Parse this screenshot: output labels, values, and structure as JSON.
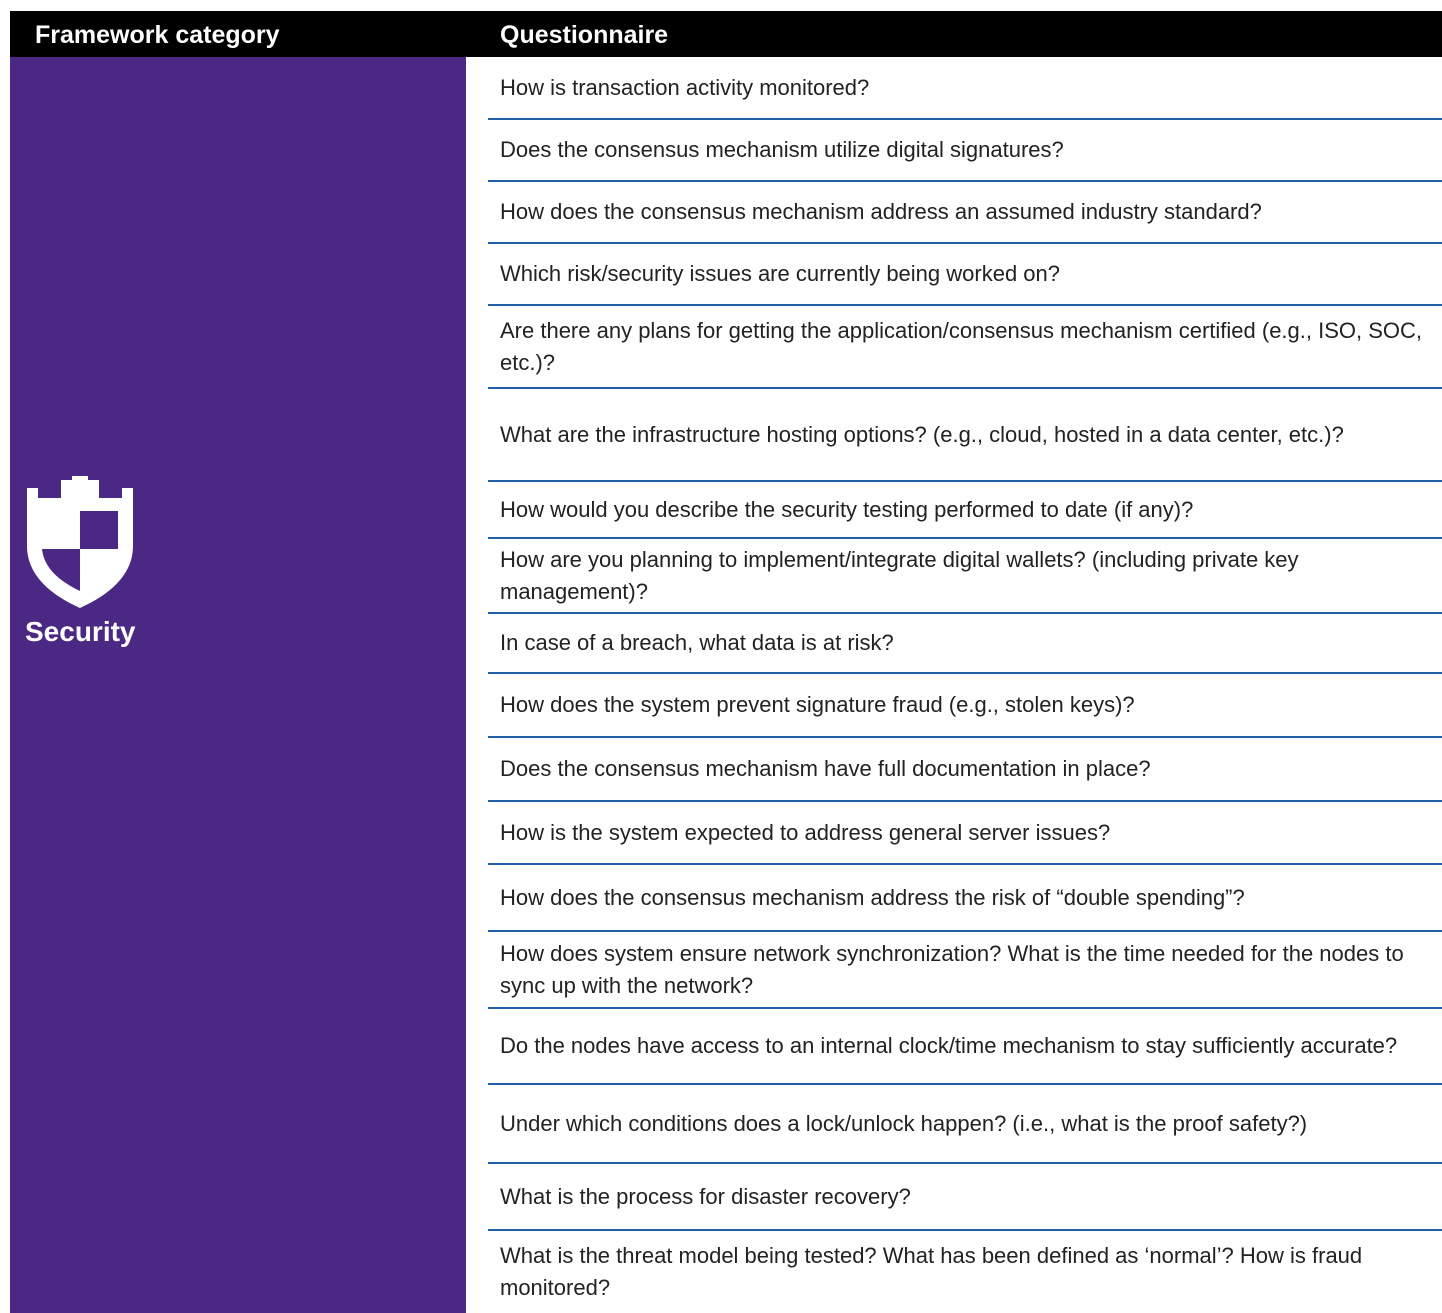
{
  "header": {
    "category_label": "Framework category",
    "questionnaire_label": "Questionnaire"
  },
  "category": {
    "label": "Security",
    "icon": "shield-icon",
    "color": "#4a2883"
  },
  "questions": [
    "How is transaction activity monitored?",
    "Does the consensus mechanism utilize digital signatures?",
    "How does the consensus mechanism address an assumed industry standard?",
    "Which risk/security issues are currently being worked on?",
    "Are there any plans for getting the application/consensus mechanism certified (e.g., ISO, SOC, etc.)?",
    "What are the infrastructure hosting options? (e.g., cloud, hosted in a data center, etc.)?",
    "How would you describe the security testing performed to date (if any)?",
    "How are you planning to implement/integrate digital wallets? (including private key management)?",
    "In case of a breach, what data is at risk?",
    "How does the system prevent signature fraud (e.g., stolen keys)?",
    "Does the consensus mechanism have full documentation in place?",
    "How is the system expected to address general server issues?",
    "How does the consensus mechanism address the risk of “double spending”?",
    "How does system ensure network synchronization? What is the time needed for the nodes to sync up with the network?",
    "Do the nodes have access to an internal clock/time mechanism to stay sufficiently accurate?",
    "Under which conditions does a lock/unlock happen? (i.e., what is the proof safety?)",
    "What is the process for disaster recovery?",
    "What is the threat model being tested? What has been defined as ‘normal’? How is fraud monitored?"
  ]
}
